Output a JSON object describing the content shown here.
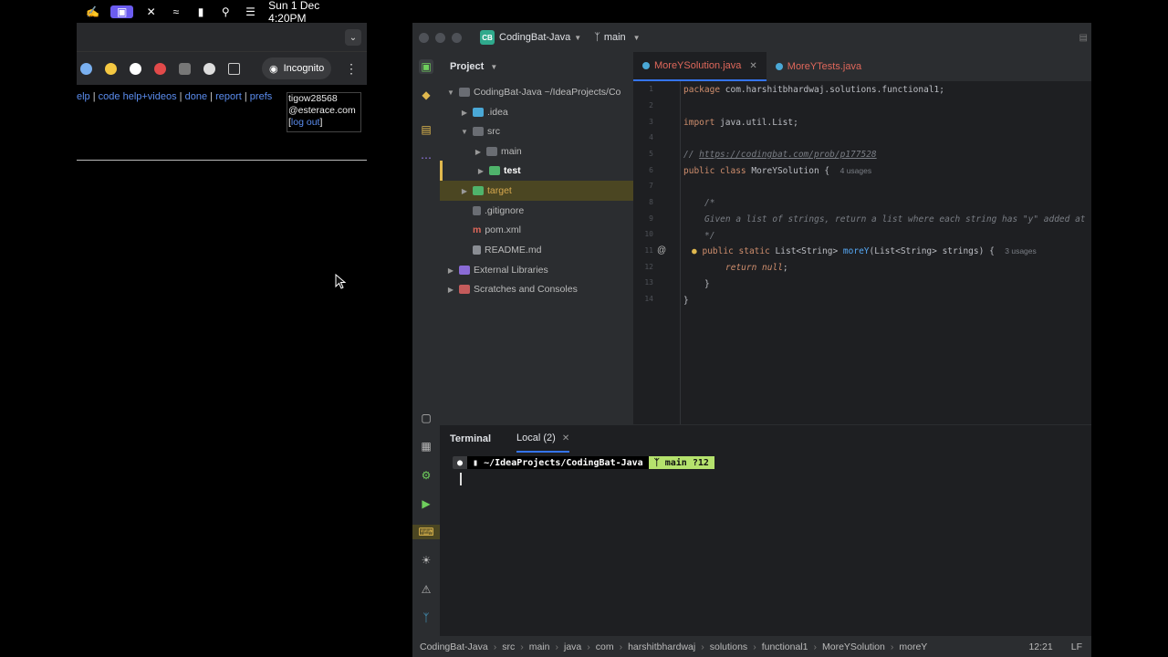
{
  "menubar": {
    "datetime": "Sun 1 Dec  4:20PM"
  },
  "browser": {
    "incognito_label": "Incognito",
    "nav_links": [
      "elp",
      "code help+videos",
      "done",
      "report",
      "prefs"
    ],
    "user_line1": "tigow28568",
    "user_line2": "@esterace.com",
    "logout_label": "log out"
  },
  "ide": {
    "project_name": "CodingBat-Java",
    "branch": "main",
    "project_panel_title": "Project",
    "tree": [
      {
        "label": "CodingBat-Java  ~/IdeaProjects/Co",
        "color": "#bbb"
      },
      {
        "label": ".idea",
        "color": "#bbb"
      },
      {
        "label": "src",
        "color": "#bbb"
      },
      {
        "label": "main",
        "color": "#bbb"
      },
      {
        "label": "test",
        "color": "#fff"
      },
      {
        "label": "target",
        "color": "#d6a84e"
      },
      {
        "label": ".gitignore",
        "color": "#bbb"
      },
      {
        "label": "pom.xml",
        "color": "#bbb"
      },
      {
        "label": "README.md",
        "color": "#bbb"
      },
      {
        "label": "External Libraries",
        "color": "#bbb"
      },
      {
        "label": "Scratches and Consoles",
        "color": "#bbb"
      }
    ],
    "tabs": [
      {
        "label": "MoreYSolution.java"
      },
      {
        "label": "MoreYTests.java"
      }
    ],
    "line_numbers": [
      "1",
      "2",
      "3",
      "4",
      "5",
      "6",
      "7",
      "8",
      "9",
      "10",
      "11",
      "12",
      "13",
      "14"
    ],
    "code": {
      "l1_kw": "package",
      "l1_rest": " com.harshitbhardwaj.solutions.functional1;",
      "l3_kw": "import",
      "l3_rest": " java.util.List;",
      "l5_prefix": "// ",
      "l5_link": "https://codingbat.com/prob/p177528",
      "l6_kw": "public class",
      "l6_rest": " MoreYSolution {",
      "l6_hint": "4 usages",
      "l8": "/*",
      "l9": "Given a list of strings, return a list where each string has \"y\" added at",
      "l10": "*/",
      "l11_kw": "public static",
      "l11_type": " List<String> ",
      "l11_fn": "moreY",
      "l11_rest": "(List<String> strings) {",
      "l11_hint": "3 usages",
      "l12_kw": "return null",
      "l12_rest": ";",
      "l13": "}",
      "l14": "}"
    },
    "terminal": {
      "title": "Terminal",
      "tab_label": "Local (2)",
      "path": "~/IdeaProjects/CodingBat-Java",
      "git": "main ?12"
    },
    "statusbar": {
      "breadcrumbs": [
        "CodingBat-Java",
        "src",
        "main",
        "java",
        "com",
        "harshitbhardwaj",
        "solutions",
        "functional1",
        "MoreYSolution",
        "moreY"
      ],
      "position": "12:21",
      "line_ending": "LF"
    }
  }
}
